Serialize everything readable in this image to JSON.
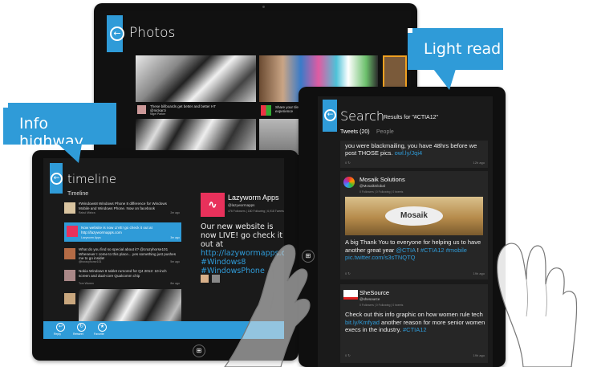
{
  "callouts": {
    "light_read": "Light read",
    "info_highway": "Info highway"
  },
  "photos_app": {
    "title": "Photos",
    "captions": [
      {
        "text": "These billboards get better and better HT @nickarzi",
        "author": "Nigel Parker"
      },
      {
        "text": "Share your tile experience",
        "author": ""
      }
    ]
  },
  "timeline_app": {
    "title": "timeline",
    "section": "Timeline",
    "tweets": [
      {
        "text": "#Windows8 Windows Phone 8 difference for Windows Mobile and Windows Phone. Now on facebook",
        "author": "Rahul Mishra",
        "time": "2m ago"
      },
      {
        "text": "Now website is now LIVE! go check it out at http://lazywormapps.com",
        "author": "Lazyworm Apps",
        "time": "3m ago"
      },
      {
        "text": "What do you find so special about it? @crazyhorse101 Whenever I come to this place... yes something just pushes me to go inside!",
        "author": "@bcrazyhorse101",
        "time": "5m ago"
      },
      {
        "text": "Nokia Windows 8 tablet rumored for Q4 2012: 10-inch screen and dual-core Qualcomm chip",
        "author": "Tom Warren",
        "time": "8m ago"
      }
    ],
    "profile": {
      "name": "Lazyworm Apps",
      "handle": "@lazywormapps",
      "stats": "476 Followers | 180 Following | 6,918 Tweets",
      "tweet_part1": "Our new website is now LIVE! go check it",
      "tweet_part2": "out at",
      "link": "http://lazywormapps.com",
      "hashtags": "#Windows8 #WindowsPhone"
    },
    "app_bar": [
      "Reply",
      "Retweet",
      "Favorite"
    ]
  },
  "search_app": {
    "title": "Search",
    "subtitle": "Results for \"#CTIA12\"",
    "tabs": [
      "Tweets (20)",
      "People"
    ],
    "tweets": [
      {
        "text_head": "you were blackmailing, you have 48hrs before we post THOSE pics.",
        "link": "owl.ly/Jqi4",
        "time": "12h ago"
      },
      {
        "name": "Mosaik Solutions",
        "handle": "@MosaikGlobal",
        "stats": "0 Followers | 0 Following | 0 tweets",
        "image_label": "Mosaik",
        "text_head": "A big Thank You to everyone for helping us to have another great year",
        "mention": "@CTIA",
        "text_mid": "!",
        "hashtags": "#CTIA12",
        "text_tail": "#mobile",
        "link": "pic.twitter.com/s3sTNQTQ",
        "time": "19h ago"
      },
      {
        "name": "SheSource",
        "handle": "@shesource",
        "stats": "0 Followers | 0 Following | 0 tweets",
        "text_head": "Check out this info graphic on how women rule tech",
        "link": "bit.ly/Kmfyad",
        "text_mid": "another reason for more senior women execs in the industry.",
        "hashtags": "#CTIA12",
        "time": "19h ago"
      }
    ]
  },
  "colors": {
    "accent": "#2f9bd8",
    "app_background": "#1a1a1a",
    "card": "#262626"
  }
}
